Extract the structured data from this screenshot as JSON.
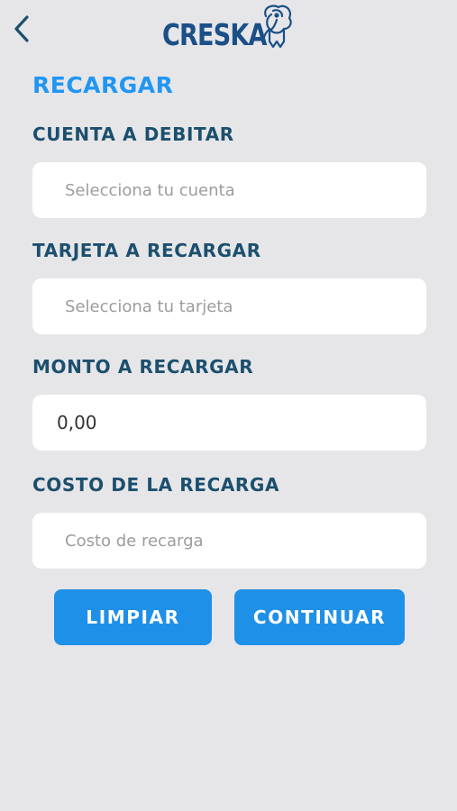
{
  "header": {
    "back_icon": "chevron-left-icon",
    "logo_text": "CRESKA",
    "mascot_icon": "elephant-mascot-icon"
  },
  "page_title": "RECARGAR",
  "form": {
    "cuenta": {
      "label": "CUENTA A DEBITAR",
      "placeholder": "Selecciona tu cuenta"
    },
    "tarjeta": {
      "label": "TARJETA A RECARGAR",
      "placeholder": "Selecciona tu tarjeta"
    },
    "monto": {
      "label": "MONTO A RECARGAR",
      "value": "0,00"
    },
    "costo": {
      "label": "COSTO DE LA RECARGA",
      "placeholder": "Costo de recarga"
    }
  },
  "buttons": {
    "clear_label": "LIMPIAR",
    "continue_label": "CONTINUAR"
  },
  "colors": {
    "background": "#e6e6e8",
    "accent": "#2196f3",
    "button": "#1e90e8",
    "label": "#1c4f6e",
    "logo": "#1b4f87"
  }
}
